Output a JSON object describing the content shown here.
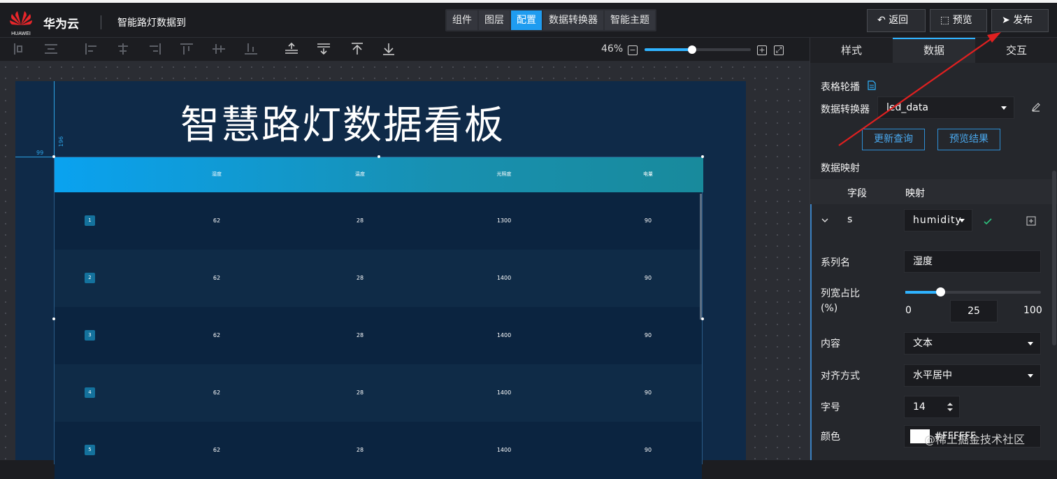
{
  "app": {
    "brand": "华为云",
    "logo_text": "HUAWEI",
    "project": "智能路灯数据到"
  },
  "tabs": [
    {
      "label": "组件",
      "active": false
    },
    {
      "label": "图层",
      "active": false
    },
    {
      "label": "配置",
      "active": true
    },
    {
      "label": "数据转换器",
      "active": false
    },
    {
      "label": "智能主题",
      "active": false
    }
  ],
  "actions": {
    "back": "返回",
    "preview": "预览",
    "publish": "发布"
  },
  "toolbar": {
    "zoom": "46%",
    "zoom_level": 0.46
  },
  "canvas": {
    "title": "智慧路灯数据看板",
    "guide_x": "99",
    "guide_y": "196",
    "table": {
      "headers": [
        "湿度",
        "温度",
        "光照度",
        "电量"
      ],
      "rows": [
        {
          "idx": "1",
          "cells": [
            "62",
            "28",
            "1300",
            "90"
          ]
        },
        {
          "idx": "2",
          "cells": [
            "62",
            "28",
            "1400",
            "90"
          ]
        },
        {
          "idx": "3",
          "cells": [
            "62",
            "28",
            "1400",
            "90"
          ]
        },
        {
          "idx": "4",
          "cells": [
            "62",
            "28",
            "1400",
            "90"
          ]
        },
        {
          "idx": "5",
          "cells": [
            "62",
            "28",
            "1400",
            "90"
          ]
        }
      ]
    }
  },
  "panel": {
    "tabs": [
      "样式",
      "数据",
      "交互"
    ],
    "active_tab": "数据",
    "component_name": "表格轮播",
    "converter_label": "数据转换器",
    "converter_value": "led_data",
    "update_query": "更新查询",
    "preview_result": "预览结果",
    "mapping_title": "数据映射",
    "col_field": "字段",
    "col_mapping": "映射",
    "field_name": "s",
    "mapping_value": "humidity",
    "series_label": "系列名",
    "series_value": "湿度",
    "width_label": "列宽占比",
    "width_unit": "(%)",
    "width_min": "0",
    "width_value": "25",
    "width_max": "100",
    "content_label": "内容",
    "content_value": "文本",
    "align_label": "对齐方式",
    "align_value": "水平居中",
    "fontsize_label": "字号",
    "fontsize_value": "14",
    "color_label": "颜色",
    "color_value": "#FFFFFF"
  },
  "watermark": "@稀土掘金技术社区",
  "colors": {
    "accent": "#1f9cf0",
    "annotation_arrow": "#e02020"
  }
}
